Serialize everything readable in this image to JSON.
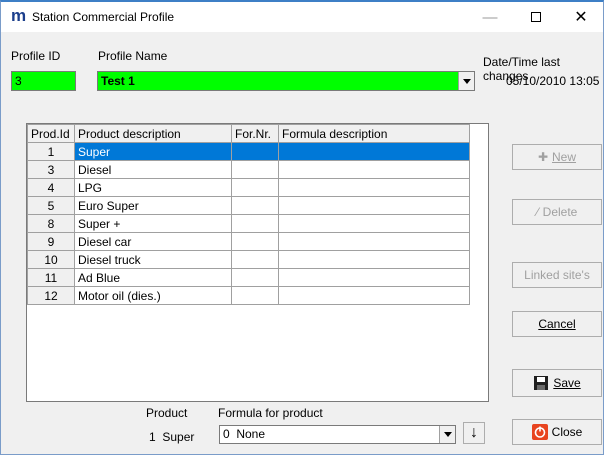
{
  "window": {
    "logo": "m",
    "title": "Station Commercial Profile",
    "min_icon": "—",
    "max_icon": "",
    "close_icon": "✕"
  },
  "header": {
    "profile_id_label": "Profile ID",
    "profile_id_value": "3",
    "profile_name_label": "Profile Name",
    "profile_name_value": "Test 1",
    "date_label": "Date/Time last changes",
    "date_value": "05/10/2010  13:05"
  },
  "grid": {
    "columns": [
      "Prod.Id",
      "Product description",
      "For.Nr.",
      "Formula description"
    ],
    "rows": [
      {
        "id": "1",
        "desc": "Super",
        "for_nr": "",
        "formula": ""
      },
      {
        "id": "3",
        "desc": "Diesel",
        "for_nr": "",
        "formula": ""
      },
      {
        "id": "4",
        "desc": "LPG",
        "for_nr": "",
        "formula": ""
      },
      {
        "id": "5",
        "desc": "Euro Super",
        "for_nr": "",
        "formula": ""
      },
      {
        "id": "8",
        "desc": "Super +",
        "for_nr": "",
        "formula": ""
      },
      {
        "id": "9",
        "desc": "Diesel car",
        "for_nr": "",
        "formula": ""
      },
      {
        "id": "10",
        "desc": "Diesel truck",
        "for_nr": "",
        "formula": ""
      },
      {
        "id": "11",
        "desc": "Ad Blue",
        "for_nr": "",
        "formula": ""
      },
      {
        "id": "12",
        "desc": "Motor oil (dies.)",
        "for_nr": "",
        "formula": ""
      }
    ]
  },
  "buttons": {
    "new": "New",
    "delete": "Delete",
    "linked": "Linked site's",
    "cancel": "Cancel",
    "save": "Save",
    "close": "Close"
  },
  "bottom": {
    "product_label": "Product",
    "product_value": "1  Super",
    "formula_label": "Formula for product",
    "formula_value": "0  None",
    "down_icon": "↓"
  },
  "colors": {
    "highlight_green": "#00ff00",
    "selection_blue": "#0078d7",
    "logo_blue": "#1c3f8c"
  },
  "icons": {
    "new": "plus-icon",
    "delete": "pencil-icon",
    "save": "floppy-disk-icon",
    "close": "power-icon"
  }
}
